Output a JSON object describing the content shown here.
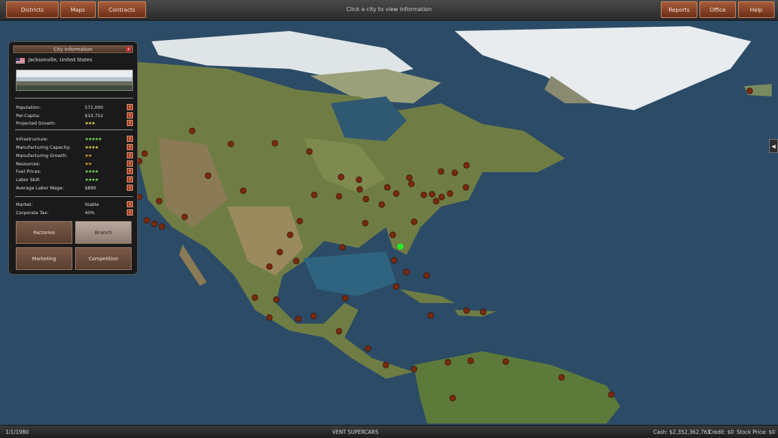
{
  "topbar": {
    "districts": "Districts",
    "maps": "Maps",
    "contracts": "Contracts",
    "hint": "Click a city to view information",
    "reports": "Reports",
    "office": "Office",
    "help": "Help"
  },
  "panel": {
    "title": "City Information",
    "close": "x",
    "location": "Jacksonville, United States",
    "rows": {
      "population": {
        "label": "Population:",
        "value": "571,000"
      },
      "percapita": {
        "label": "Per-Capita:",
        "value": "$10,752"
      },
      "growth": {
        "label": "Projected Growth:",
        "value": "★★★"
      },
      "infrastructure": {
        "label": "Infrastructure:",
        "value": "★★★★★"
      },
      "mfg_capacity": {
        "label": "Manufacturing Capacity:",
        "value": "★★★★"
      },
      "mfg_growth": {
        "label": "Manufacturing Growth:",
        "value": "★★"
      },
      "resources": {
        "label": "Resources:",
        "value": "★★"
      },
      "fuel": {
        "label": "Fuel Prices:",
        "value": "★★★★"
      },
      "labor": {
        "label": "Labor Skill:",
        "value": "★★★★"
      },
      "wage": {
        "label": "Average Labor Wage:",
        "value": "$890"
      },
      "market": {
        "label": "Market:",
        "value": "Stable"
      },
      "tax": {
        "label": "Corporate Tax:",
        "value": "40%"
      }
    },
    "help_symbol": "?",
    "buttons": {
      "factories": "Factories",
      "branch": "Branch",
      "marketing": "Marketing",
      "competition": "Competition"
    }
  },
  "status": {
    "date": "1/1/1980",
    "company": "VENT SUPERCARS",
    "cash": "Cash: $2,352,362,763",
    "credit": "Credit: $0",
    "stock": "Stock Price: $0"
  },
  "sidetab": "◀",
  "colors": {
    "city": "#7a2a10",
    "selected_city": "#22ee22",
    "ocean": "#2b4a63",
    "land": "#6f7d45"
  }
}
